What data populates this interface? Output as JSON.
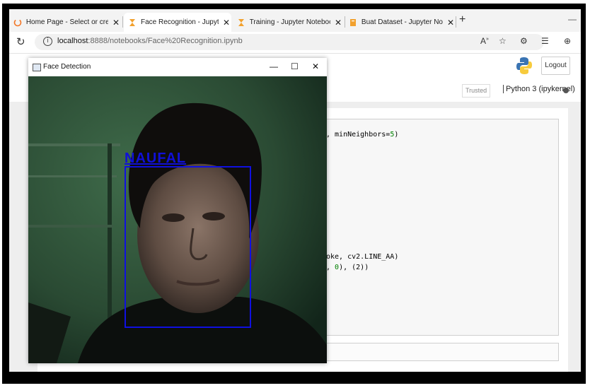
{
  "browser": {
    "tabs": [
      {
        "label": "Home Page - Select or create a n",
        "active": false,
        "icon": "jupyter-spinner-icon"
      },
      {
        "label": "Face Recognition - Jupyter Notel",
        "active": true,
        "icon": "hourglass-icon"
      },
      {
        "label": "Training - Jupyter Notebook",
        "active": false,
        "icon": "hourglass-icon"
      },
      {
        "label": "Buat Dataset - Jupyter Notebook",
        "active": false,
        "icon": "notebook-icon"
      }
    ],
    "new_tab_symbol": "+",
    "close_symbol": "✕",
    "url_host": "localhost",
    "url_path": ":8888/notebooks/Face%20Recognition.ipynb"
  },
  "jupyter": {
    "logout_label": "Logout",
    "trusted_label": "Trusted",
    "kernel_label": "Python 3 (ipykernel)",
    "code_lines": [
      {
        "text": ", minNeighbors=",
        "num": "5",
        "tail": ")"
      },
      {
        "text": "oke, cv2.LINE_AA)",
        "num": "",
        "tail": ""
      },
      {
        "text": ", ",
        "num": "0",
        "tail": "), (2))"
      }
    ]
  },
  "face_window": {
    "title": "Face Detection",
    "minimize": "—",
    "maximize": "☐",
    "close": "✕",
    "detected_name": "NAUFAL",
    "box_color": "#1010e0"
  }
}
